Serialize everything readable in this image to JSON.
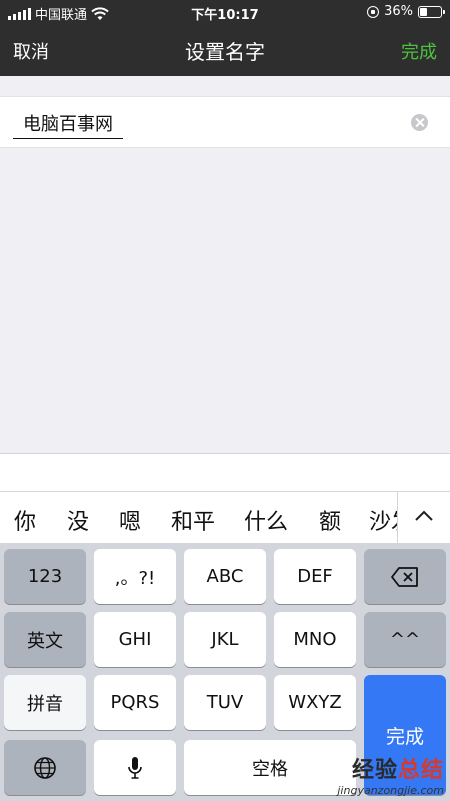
{
  "status_bar": {
    "carrier": "中国联通",
    "time": "下午10:17",
    "battery": "36%",
    "battery_level": 0.36
  },
  "nav": {
    "cancel": "取消",
    "title": "设置名字",
    "done": "完成",
    "done_color": "#4cc33e"
  },
  "name_field": {
    "value": "电脑百事网",
    "clear_icon": "clear-circle-icon"
  },
  "candidates": [
    "你",
    "没",
    "嗯",
    "和平",
    "什么",
    "额",
    "沙发"
  ],
  "keyboard": {
    "row1": [
      "123",
      ",。?!",
      "ABC",
      "DEF"
    ],
    "backspace_icon": "backspace-icon",
    "row2": [
      "英文",
      "GHI",
      "JKL",
      "MNO",
      "^^"
    ],
    "row3": [
      "拼音",
      "PQRS",
      "TUV",
      "WXYZ"
    ],
    "done": "完成",
    "done_color": "#3478f6",
    "globe_icon": "globe-icon",
    "mic_icon": "microphone-icon",
    "space": "空格"
  },
  "watermark": {
    "cn_part1": "经验",
    "cn_part2": "总结",
    "url": "jingyanzongjie.com"
  }
}
